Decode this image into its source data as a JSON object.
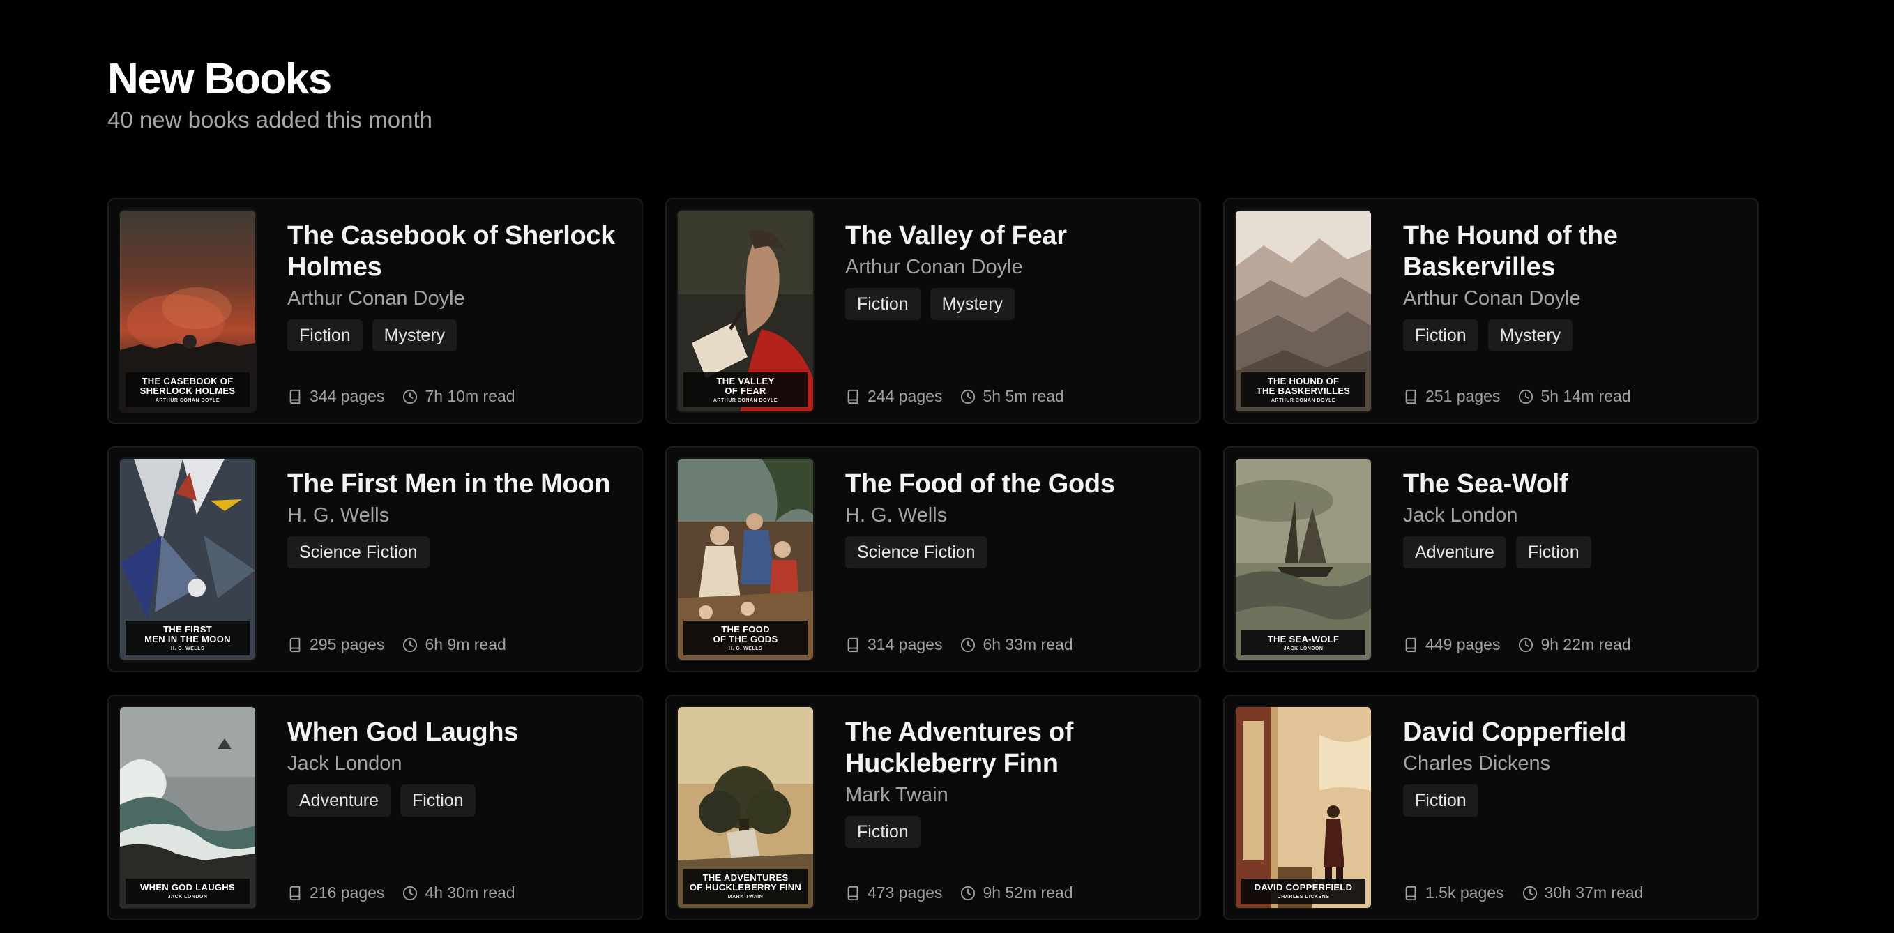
{
  "header": {
    "title": "New Books",
    "subtitle": "40 new books added this month"
  },
  "books": [
    {
      "title": "The Casebook of Sherlock Holmes",
      "author": "Arthur Conan Doyle",
      "tags": [
        "Fiction",
        "Mystery"
      ],
      "pages": "344 pages",
      "read_time": "7h 10m read",
      "cover_title": "THE CASEBOOK OF\nSHERLOCK HOLMES",
      "cover_author": "ARTHUR CONAN DOYLE",
      "cover_art": "fire-landscape"
    },
    {
      "title": "The Valley of Fear",
      "author": "Arthur Conan Doyle",
      "tags": [
        "Fiction",
        "Mystery"
      ],
      "pages": "244 pages",
      "read_time": "5h 5m read",
      "cover_title": "THE VALLEY\nOF FEAR",
      "cover_author": "ARTHUR CONAN DOYLE",
      "cover_art": "man-with-pipe"
    },
    {
      "title": "The Hound of the Baskervilles",
      "author": "Arthur Conan Doyle",
      "tags": [
        "Fiction",
        "Mystery"
      ],
      "pages": "251 pages",
      "read_time": "5h 14m read",
      "cover_title": "THE HOUND OF\nTHE BASKERVILLES",
      "cover_author": "ARTHUR CONAN DOYLE",
      "cover_art": "misty-mountains"
    },
    {
      "title": "The First Men in the Moon",
      "author": "H. G. Wells",
      "tags": [
        "Science Fiction"
      ],
      "pages": "295 pages",
      "read_time": "6h 9m read",
      "cover_title": "THE FIRST\nMEN IN THE MOON",
      "cover_author": "H. G. WELLS",
      "cover_art": "abstract-shapes"
    },
    {
      "title": "The Food of the Gods",
      "author": "H. G. Wells",
      "tags": [
        "Science Fiction"
      ],
      "pages": "314 pages",
      "read_time": "6h 33m read",
      "cover_title": "THE FOOD\nOF THE GODS",
      "cover_author": "H. G. WELLS",
      "cover_art": "classical-painting"
    },
    {
      "title": "The Sea-Wolf",
      "author": "Jack London",
      "tags": [
        "Adventure",
        "Fiction"
      ],
      "pages": "449 pages",
      "read_time": "9h 22m read",
      "cover_title": "THE SEA-WOLF",
      "cover_author": "JACK LONDON",
      "cover_art": "stormy-ship"
    },
    {
      "title": "When God Laughs",
      "author": "Jack London",
      "tags": [
        "Adventure",
        "Fiction"
      ],
      "pages": "216 pages",
      "read_time": "4h 30m read",
      "cover_title": "WHEN GOD LAUGHS",
      "cover_author": "JACK LONDON",
      "cover_art": "crashing-waves"
    },
    {
      "title": "The Adventures of Huckleberry Finn",
      "author": "Mark Twain",
      "tags": [
        "Fiction"
      ],
      "pages": "473 pages",
      "read_time": "9h 52m read",
      "cover_title": "THE ADVENTURES\nOF HUCKLEBERRY FINN",
      "cover_author": "MARK TWAIN",
      "cover_art": "tree-scene"
    },
    {
      "title": "David Copperfield",
      "author": "Charles Dickens",
      "tags": [
        "Fiction"
      ],
      "pages": "1.5k pages",
      "read_time": "30h 37m read",
      "cover_title": "DAVID COPPERFIELD",
      "cover_author": "CHARLES DICKENS",
      "cover_art": "interior-figure"
    }
  ],
  "icons": {
    "pages": "book-icon",
    "read_time": "clock-icon"
  }
}
